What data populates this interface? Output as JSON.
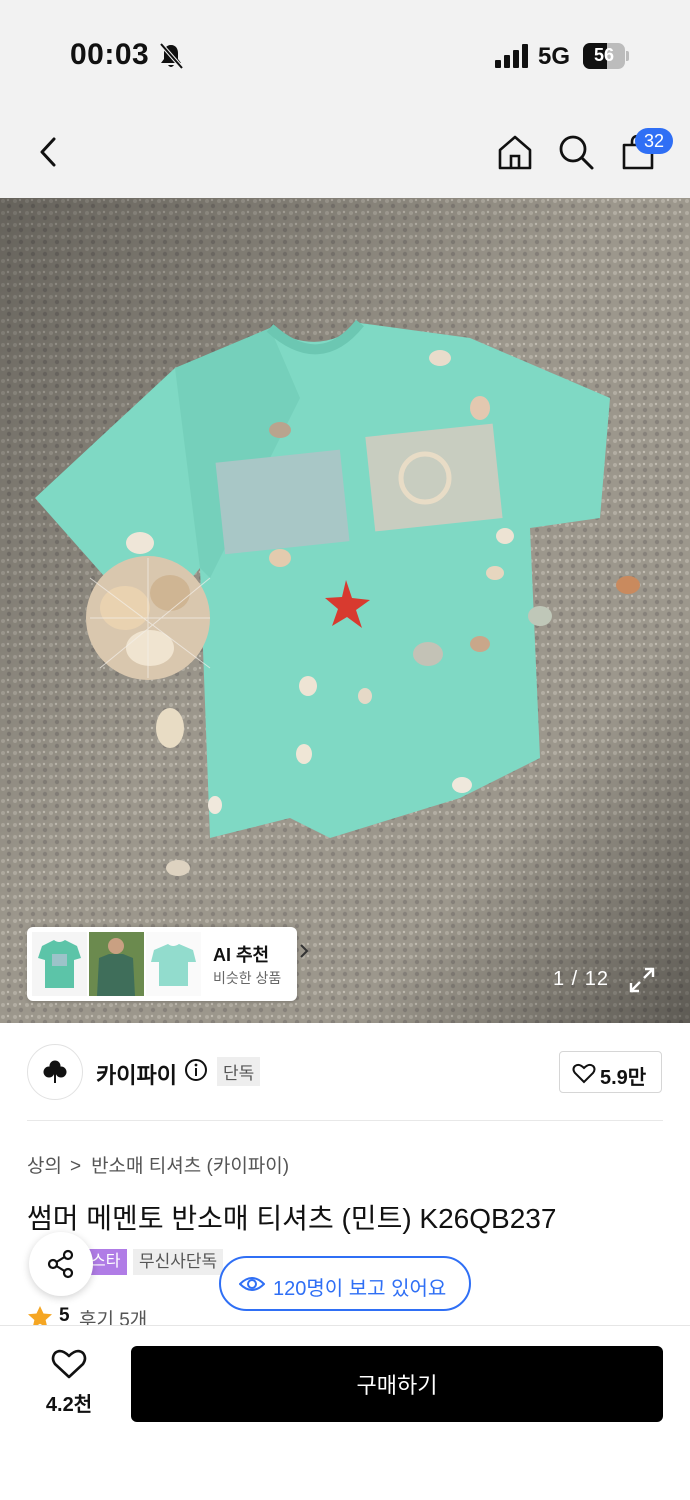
{
  "status_bar": {
    "time": "00:03",
    "network": "5G",
    "battery": "56",
    "battery_level": 0.56
  },
  "header": {
    "back_icon": "chevron-left-icon",
    "home_icon": "home-icon",
    "search_icon": "search-icon",
    "cart_icon": "shopping-bag-icon",
    "cart_count": "32"
  },
  "gallery": {
    "current_page": "1 / 12",
    "ai_recommend": {
      "title": "AI 추천",
      "subtitle": "비슷한 상품"
    }
  },
  "brand": {
    "name": "카이파이",
    "exclusive_label": "단독",
    "like_count": "5.9만"
  },
  "product": {
    "breadcrumb": [
      "상의",
      "반소매 티셔츠 (카이파이)"
    ],
    "title": "썸머 메멘토 반소매 티셔츠 (민트) K26QB237",
    "tags": [
      "스타",
      "무신사단독"
    ],
    "viewers": "120명이 보고 있어요",
    "rating": "5",
    "reviews": "후기 5개"
  },
  "bottom_bar": {
    "wish_count": "4.2천",
    "buy_label": "구매하기"
  },
  "colors": {
    "accent_blue": "#2f6ff5",
    "tag_purple": "#b07ce6",
    "star_orange": "#f5a623",
    "mint_shirt": "#7fd9c4"
  }
}
